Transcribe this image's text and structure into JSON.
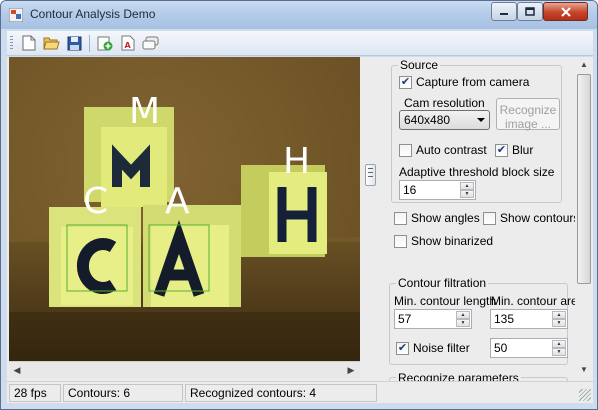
{
  "window": {
    "title": "Contour Analysis Demo"
  },
  "toolbar": {
    "buttons": [
      "new-icon",
      "open-icon",
      "save-icon",
      "add-template-icon",
      "pdf-icon",
      "templates-icon"
    ]
  },
  "camera": {
    "labels": [
      "M",
      "C",
      "A",
      "H"
    ]
  },
  "source": {
    "group_label": "Source",
    "capture_label": "Capture from camera",
    "capture_checked": true,
    "cam_resolution_label": "Cam resolution",
    "cam_resolution_value": "640x480",
    "recognize_button": "Recognize image ...",
    "auto_contrast_label": "Auto contrast",
    "auto_contrast_checked": false,
    "blur_label": "Blur",
    "blur_checked": true,
    "threshold_label": "Adaptive threshold block size",
    "threshold_value": "16"
  },
  "display": {
    "show_angles": "Show angles",
    "show_contours": "Show contours",
    "show_binarized": "Show binarized"
  },
  "filtration": {
    "group_label": "Contour filtration",
    "min_length_label": "Min. contour length",
    "min_length_value": "57",
    "min_area_label": "Min. contour area",
    "min_area_value": "135",
    "noise_filter_label": "Noise filter",
    "noise_filter_checked": true,
    "noise_filter_value": "50"
  },
  "recognize_params": {
    "group_label": "Recognize parameters"
  },
  "status": {
    "fps": "28 fps",
    "contours": "Contours: 6",
    "recognized": "Recognized contours: 4"
  }
}
